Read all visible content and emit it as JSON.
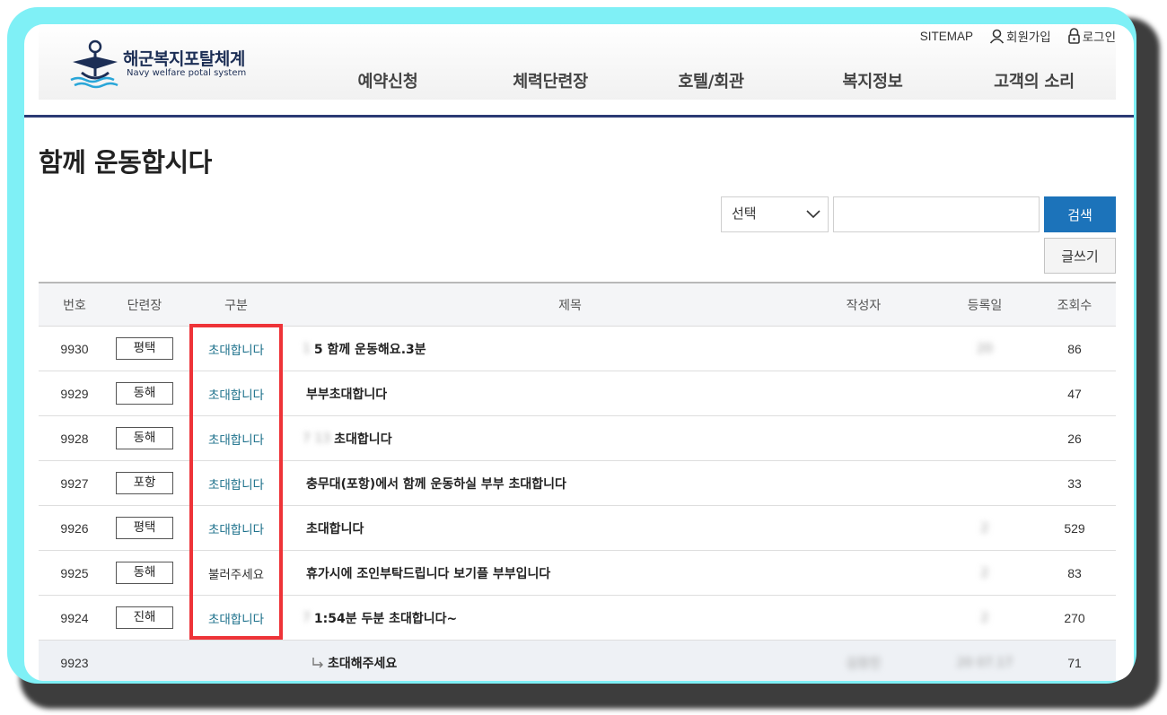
{
  "header": {
    "logo_title": "해군복지포탈체계",
    "logo_subtitle": "Navy welfare potal system",
    "util": {
      "sitemap": "SITEMAP",
      "signup": "회원가입",
      "login": "로그인"
    },
    "nav": [
      "예약신청",
      "체력단련장",
      "호텔/회관",
      "복지정보",
      "고객의 소리"
    ]
  },
  "page_title": "함께 운동합시다",
  "search": {
    "select_value": "선택",
    "input_value": "",
    "button_label": "검색",
    "write_label": "글쓰기"
  },
  "table": {
    "headers": [
      "번호",
      "단련장",
      "구분",
      "제목",
      "작성자",
      "등록일",
      "조회수"
    ],
    "rows": [
      {
        "num": "9930",
        "loc": "평택",
        "cat": "초대합니다",
        "title_blur": "1",
        "title": "5 함께 운동해요.3분",
        "author": "",
        "date": "20",
        "views": "86"
      },
      {
        "num": "9929",
        "loc": "동해",
        "cat": "초대합니다",
        "title_blur": "",
        "title": "부부초대합니다",
        "author": "",
        "date": "",
        "views": "47"
      },
      {
        "num": "9928",
        "loc": "동해",
        "cat": "초대합니다",
        "title_blur": "7 13",
        "title": "초대합니다",
        "author": "",
        "date": "",
        "views": "26"
      },
      {
        "num": "9927",
        "loc": "포항",
        "cat": "초대합니다",
        "title_blur": "",
        "title": "충무대(포항)에서 함께 운동하실 부부 초대합니다",
        "author": "",
        "date": "",
        "views": "33"
      },
      {
        "num": "9926",
        "loc": "평택",
        "cat": "초대합니다",
        "title_blur": "",
        "title": "초대합니다",
        "author": "",
        "date": "2",
        "views": "529"
      },
      {
        "num": "9925",
        "loc": "동해",
        "cat": "불러주세요",
        "title_blur": "",
        "title": "휴가시에 조인부탁드립니다 보기플 부부입니다",
        "author": "",
        "date": "2",
        "views": "83"
      },
      {
        "num": "9924",
        "loc": "진해",
        "cat": "초대합니다",
        "title_blur": "7",
        "title": "1:54분 두분 초대합니다~",
        "author": "",
        "date": "2",
        "views": "270"
      },
      {
        "num": "9923",
        "loc": "",
        "cat": "",
        "title_blur": "",
        "title": "초대해주세요",
        "author": "김창진",
        "date": "20 07.17",
        "views": "71"
      }
    ]
  },
  "colors": {
    "accent": "#1c73ba",
    "navy": "#2b3a74",
    "frame": "#7ff0f6",
    "highlight": "#ee3338"
  }
}
